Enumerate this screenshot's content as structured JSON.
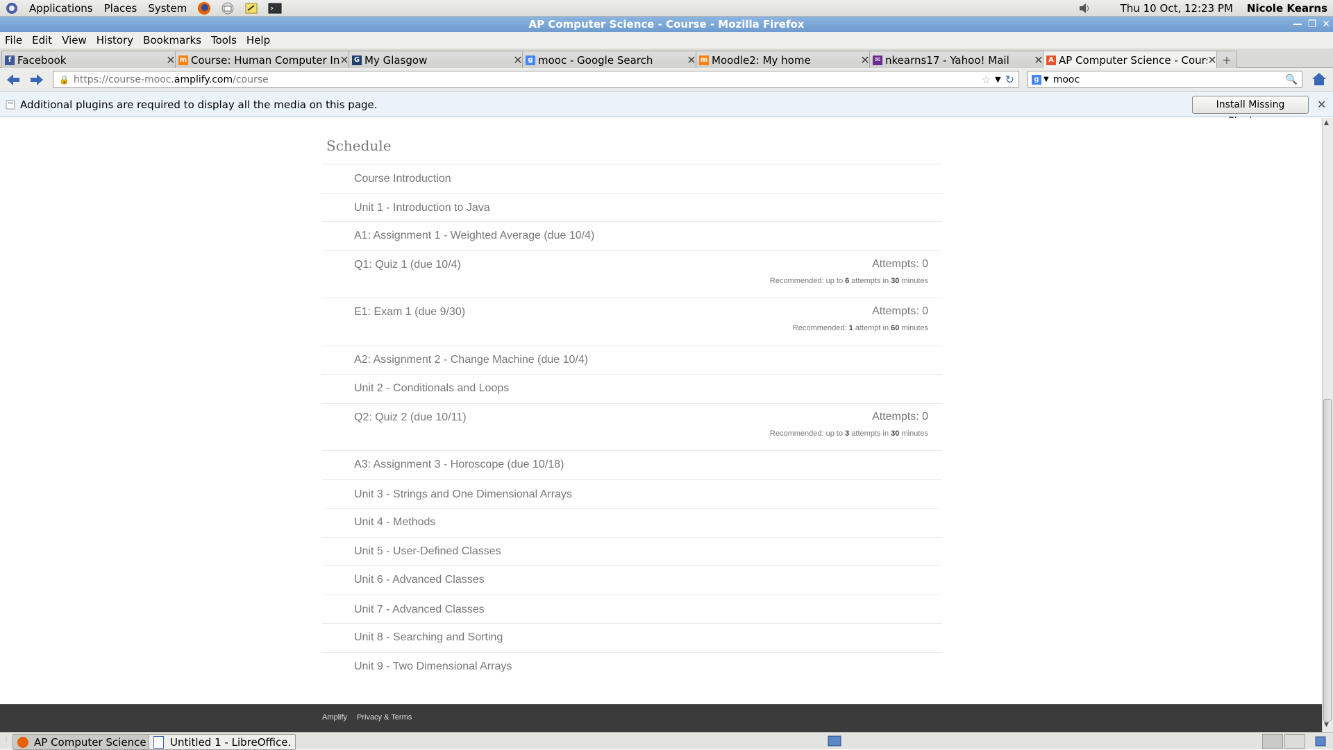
{
  "panel": {
    "menus": [
      "Applications",
      "Places",
      "System"
    ],
    "datetime": "Thu 10 Oct, 12:23 PM",
    "user": "Nicole Kearns"
  },
  "window": {
    "title": "AP Computer Science - Course - Mozilla Firefox"
  },
  "menubar": [
    "File",
    "Edit",
    "View",
    "History",
    "Bookmarks",
    "Tools",
    "Help"
  ],
  "tabs": [
    {
      "label": "Facebook",
      "icon": "facebook-icon",
      "color": "#3b5998"
    },
    {
      "label": "Course: Human Computer In...",
      "icon": "moodle-icon",
      "color": "#f98012"
    },
    {
      "label": "My Glasgow",
      "icon": "glasgow-icon",
      "color": "#1f3f6e"
    },
    {
      "label": "mooc - Google Search",
      "icon": "google-icon",
      "color": "#4285f4"
    },
    {
      "label": "Moodle2: My home",
      "icon": "moodle-icon",
      "color": "#f98012"
    },
    {
      "label": "nkearns17 - Yahoo! Mail",
      "icon": "mail-icon",
      "color": "#6b2c91"
    },
    {
      "label": "AP Computer Science - Course",
      "icon": "amplify-icon",
      "color": "#e8542c",
      "active": true
    }
  ],
  "navbar": {
    "url_prefix": "https://course-mooc.",
    "url_domain": "amplify.com",
    "url_path": "/course",
    "search_value": "mooc"
  },
  "pluginbar": {
    "message": "Additional plugins are required to display all the media on this page.",
    "button": "Install Missing Plugins..."
  },
  "schedule": {
    "title": "Schedule",
    "items": [
      {
        "label": "Course Introduction"
      },
      {
        "label": "Unit 1 - Introduction to Java"
      },
      {
        "label": "A1: Assignment 1 - Weighted Average (due 10/4)"
      },
      {
        "label": "Q1: Quiz 1 (due 10/4)",
        "attempts": "Attempts: 0",
        "rec": {
          "pre": "Recommended: up to ",
          "n": "6",
          "mid": " attempts in ",
          "t": "30",
          "post": " minutes"
        }
      },
      {
        "label": "E1: Exam 1 (due 9/30)",
        "attempts": "Attempts: 0",
        "rec": {
          "pre": "Recommended: ",
          "n": "1",
          "mid": " attempt in ",
          "t": "60",
          "post": " minutes"
        }
      },
      {
        "label": "A2: Assignment 2 - Change Machine (due 10/4)"
      },
      {
        "label": "Unit 2 - Conditionals and Loops"
      },
      {
        "label": "Q2: Quiz 2 (due 10/11)",
        "attempts": "Attempts: 0",
        "rec": {
          "pre": "Recommended: up to ",
          "n": "3",
          "mid": " attempts in ",
          "t": "30",
          "post": " minutes"
        }
      },
      {
        "label": "A3: Assignment 3 - Horoscope (due 10/18)"
      },
      {
        "label": "Unit 3 - Strings and One Dimensional Arrays"
      },
      {
        "label": "Unit 4 - Methods"
      },
      {
        "label": "Unit 5 - User-Defined Classes"
      },
      {
        "label": "Unit 6 - Advanced Classes"
      },
      {
        "label": "Unit 7 - Advanced Classes"
      },
      {
        "label": "Unit 8 - Searching and Sorting"
      },
      {
        "label": "Unit 9 - Two Dimensional Arrays"
      }
    ]
  },
  "footer": {
    "links": [
      "Amplify",
      "Privacy & Terms"
    ]
  },
  "taskbar": {
    "items": [
      "AP Computer Science -...",
      "Untitled 1 - LibreOffice..."
    ]
  }
}
